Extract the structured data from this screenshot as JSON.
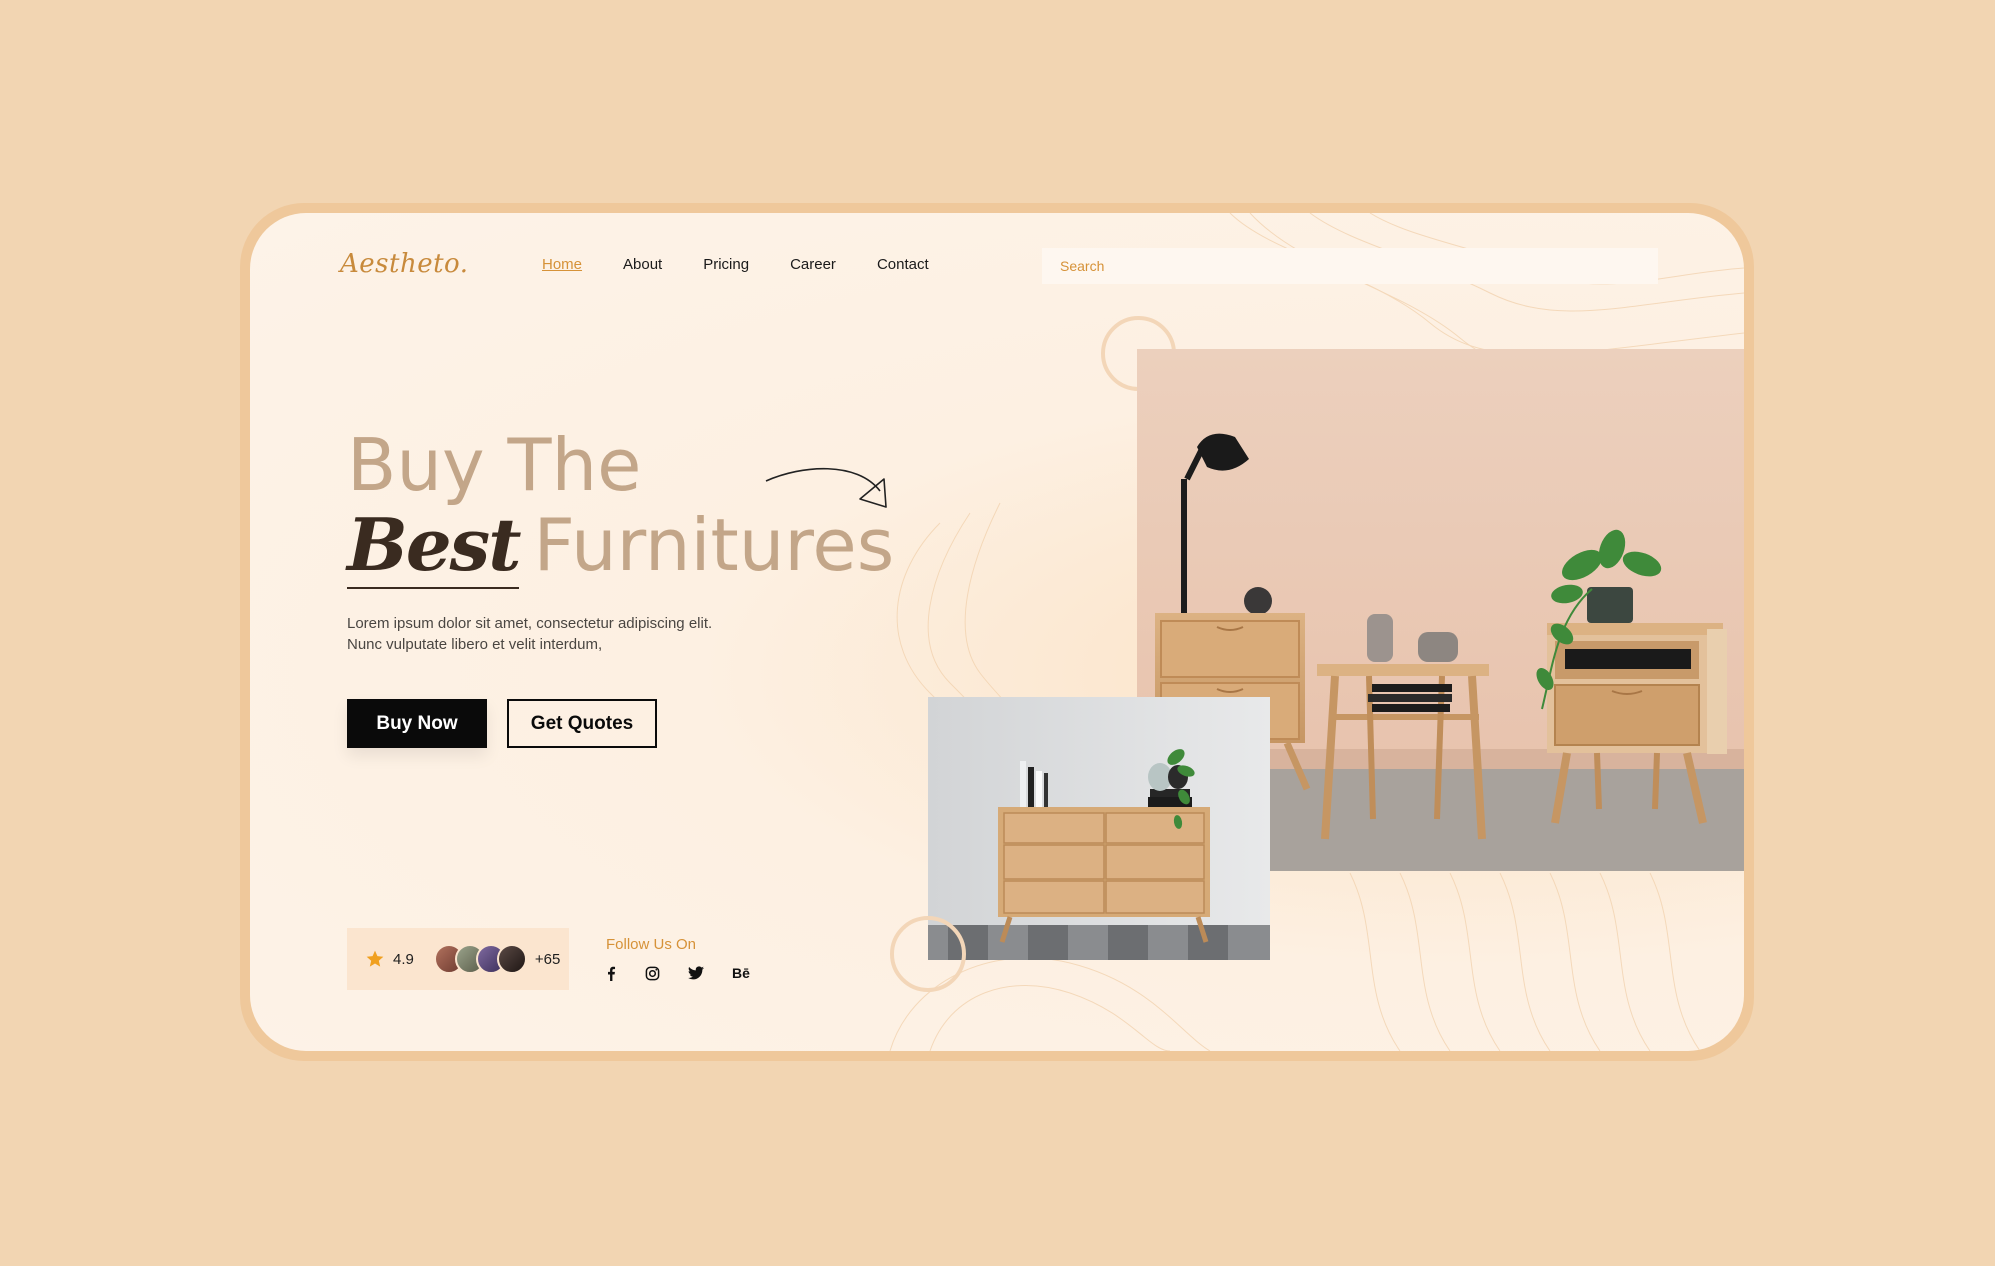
{
  "brand": {
    "logo": "Aestheto."
  },
  "nav": {
    "items": [
      {
        "label": "Home",
        "active": true
      },
      {
        "label": "About"
      },
      {
        "label": "Pricing"
      },
      {
        "label": "Career"
      },
      {
        "label": "Contact"
      }
    ]
  },
  "search": {
    "placeholder": "Search"
  },
  "hero": {
    "line1": "Buy The",
    "best": "Best",
    "furnitures": "Furnitures",
    "description": "Lorem ipsum dolor sit amet, consectetur adipiscing elit. Nunc vulputate libero et velit interdum,",
    "buy_label": "Buy Now",
    "quotes_label": "Get Quotes"
  },
  "rating": {
    "score": "4.9",
    "extra": "+65",
    "star_icon": "star-icon",
    "star_color": "#f0a020"
  },
  "social": {
    "title": "Follow Us On",
    "icons": [
      "facebook-icon",
      "instagram-icon",
      "twitter-icon",
      "behance-icon"
    ],
    "behance_text": "Bē"
  },
  "colors": {
    "accent": "#d69238",
    "background": "#f2d5b2",
    "card": "#fdf3e8",
    "heading": "#c3a689",
    "dark": "#0a0a0a"
  }
}
